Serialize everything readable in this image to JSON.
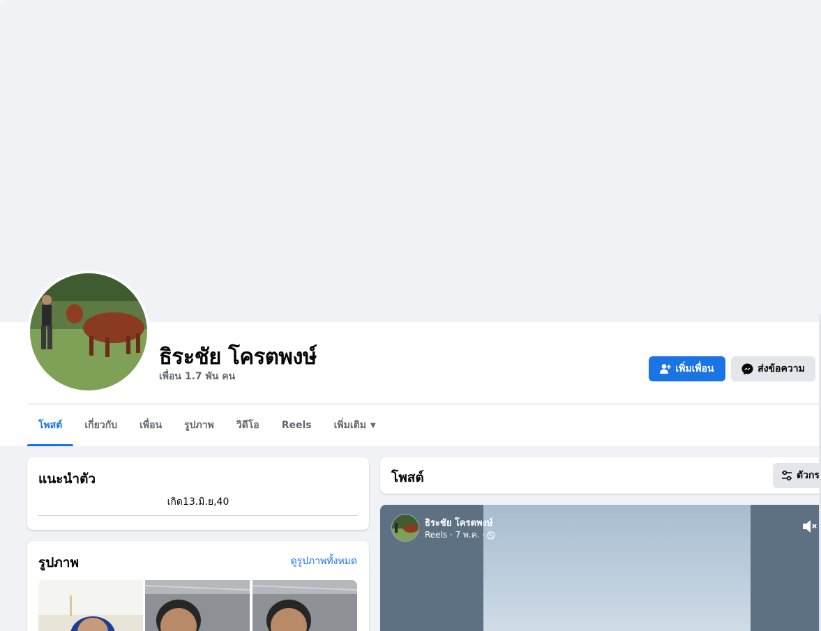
{
  "profile": {
    "name": "ธิระชัย โครตพงษ์",
    "friends": "เพื่อน 1.7 พัน คน"
  },
  "actions": {
    "add_friend": "เพิ่มเพื่อน",
    "message": "ส่งข้อความ"
  },
  "tabs": [
    {
      "label": "โพสต์",
      "active": true
    },
    {
      "label": "เกี่ยวกับ",
      "active": false
    },
    {
      "label": "เพื่อน",
      "active": false
    },
    {
      "label": "รูปภาพ",
      "active": false
    },
    {
      "label": "วิดีโอ",
      "active": false
    },
    {
      "label": "Reels",
      "active": false
    },
    {
      "label": "เพิ่มเติม",
      "active": false
    }
  ],
  "intro": {
    "title": "แนะนำตัว",
    "bio": "เกิด13.มิ.ย,40"
  },
  "photos": {
    "title": "รูปภาพ",
    "see_all": "ดูรูปภาพทั้งหมด"
  },
  "posts": {
    "title": "โพสต์",
    "filter_label": "ตัวกร"
  },
  "reel_post": {
    "author": "ธิระชัย โครตพงษ์",
    "meta": "Reels · 7 พ.ค. ·"
  },
  "colors": {
    "accent": "#1b74e4",
    "page_bg": "#f0f2f5",
    "secondary_text": "#65676b"
  }
}
